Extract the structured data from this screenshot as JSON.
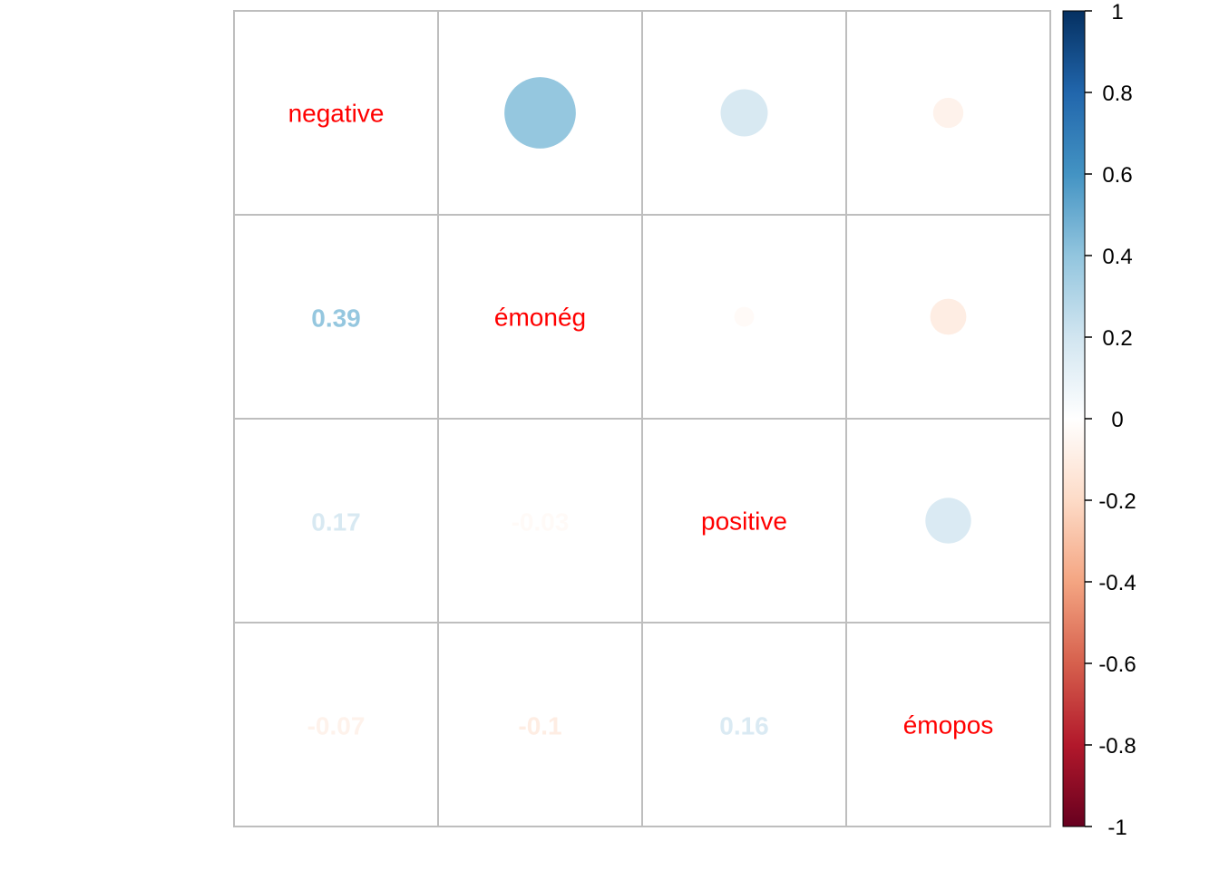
{
  "chart_data": {
    "type": "heatmap",
    "variables": [
      "negative",
      "émonég",
      "positive",
      "émopos"
    ],
    "correlation": [
      [
        1,
        0.39,
        0.17,
        -0.07
      ],
      [
        0.39,
        1,
        -0.03,
        -0.1
      ],
      [
        0.17,
        -0.03,
        1,
        0.16
      ],
      [
        -0.07,
        -0.1,
        0.16,
        1
      ]
    ],
    "coefficient_labels": [
      {
        "row": 1,
        "col": 0,
        "text": "0.39",
        "value": 0.39
      },
      {
        "row": 2,
        "col": 0,
        "text": "0.17",
        "value": 0.17
      },
      {
        "row": 2,
        "col": 1,
        "text": "-0.03",
        "value": -0.03
      },
      {
        "row": 3,
        "col": 0,
        "text": "-0.07",
        "value": -0.07
      },
      {
        "row": 3,
        "col": 1,
        "text": "-0.1",
        "value": -0.1
      },
      {
        "row": 3,
        "col": 2,
        "text": "0.16",
        "value": 0.16
      }
    ],
    "upper_method": "circle",
    "lower_method": "number",
    "diagonal_label_color": "#FF0000",
    "color_scale": {
      "range": [
        -1,
        1
      ],
      "ticks": [
        "1",
        "0.8",
        "0.6",
        "0.4",
        "0.2",
        "0",
        "-0.2",
        "-0.4",
        "-0.6",
        "-0.8",
        "-1"
      ],
      "tick_values": [
        1,
        0.8,
        0.6,
        0.4,
        0.2,
        0,
        -0.2,
        -0.4,
        -0.6,
        -0.8,
        -1
      ],
      "colors": [
        "#67001F",
        "#B2182B",
        "#D6604D",
        "#F4A582",
        "#FDDBC7",
        "#FFFFFF",
        "#D1E5F0",
        "#92C5DE",
        "#4393C3",
        "#2166AC",
        "#053061"
      ]
    },
    "grid_color": "#BEBEBE"
  }
}
